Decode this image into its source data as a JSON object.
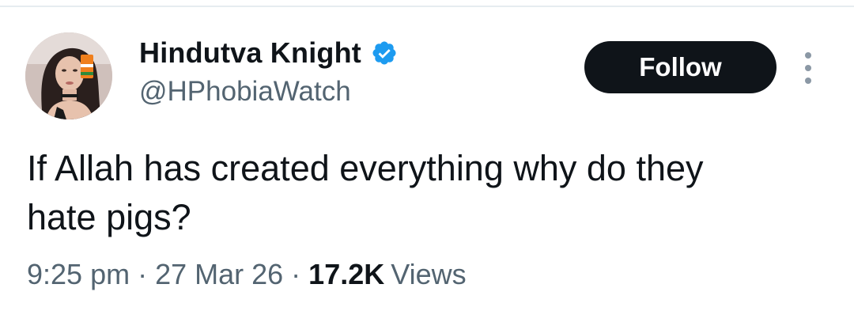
{
  "tweet": {
    "author": {
      "display_name": "Hindutva Knight",
      "handle": "@HPhobiaWatch",
      "verified": true,
      "avatar_icon": "profile-photo",
      "verified_icon": "verified-badge-icon",
      "verified_color": "#1d9bf0"
    },
    "follow_label": "Follow",
    "more_icon": "more-options-icon",
    "text": "If Allah has created everything why do they\nhate pigs?",
    "time": "9:25 pm",
    "date": "27 Mar 26",
    "separator": "·",
    "views_count": "17.2K",
    "views_label": "Views"
  },
  "colors": {
    "text_primary": "#0f1419",
    "text_secondary": "#536471",
    "follow_bg": "#0f1419",
    "follow_text": "#ffffff",
    "background": "#ffffff"
  }
}
